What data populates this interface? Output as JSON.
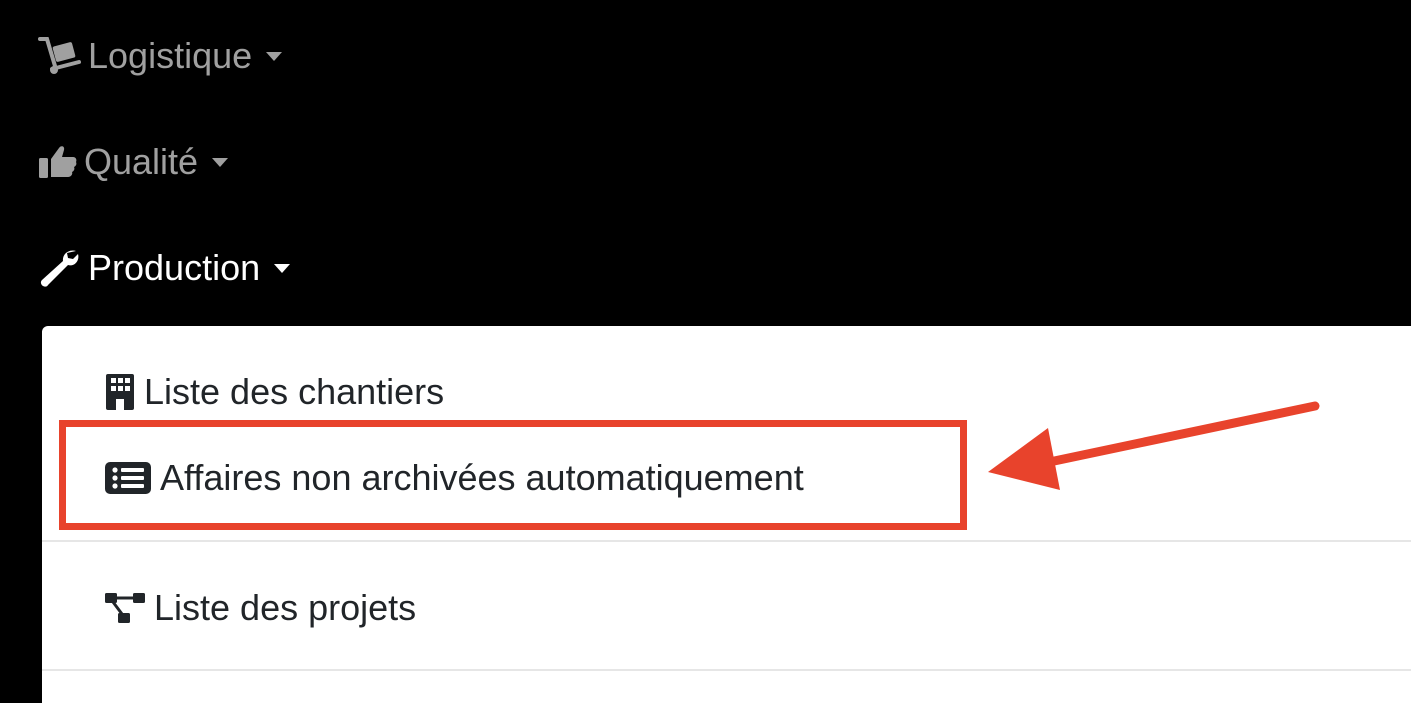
{
  "nav": {
    "items": [
      {
        "label": "Logistique",
        "icon": "dolly-icon",
        "state": "collapsed"
      },
      {
        "label": "Qualité",
        "icon": "thumbs-up-icon",
        "state": "collapsed"
      },
      {
        "label": "Production",
        "icon": "wrench-icon",
        "state": "expanded"
      }
    ]
  },
  "production_menu": {
    "items": [
      {
        "label": "Liste des chantiers",
        "icon": "building-icon"
      },
      {
        "label": "Affaires non archivées automatiquement",
        "icon": "list-icon",
        "highlighted": true
      },
      {
        "label": "Liste des projets",
        "icon": "project-diagram-icon"
      }
    ]
  },
  "colors": {
    "navbar_bg": "#000000",
    "nav_text": "#a0a0a0",
    "nav_active_text": "#ffffff",
    "dropdown_bg": "#ffffff",
    "dropdown_text": "#212529",
    "annotation": "#e8432c"
  }
}
